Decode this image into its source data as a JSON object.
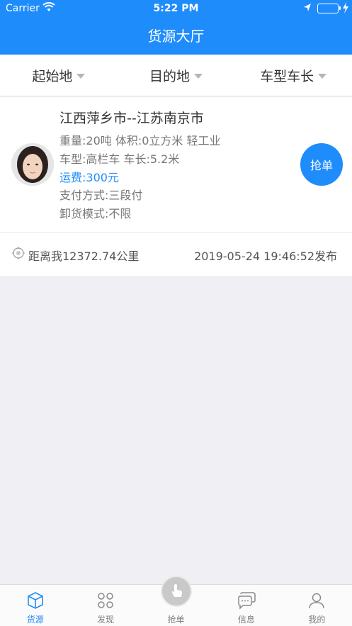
{
  "status_bar": {
    "carrier": "Carrier",
    "time": "5:22 PM",
    "battery_level": 1.0
  },
  "nav": {
    "title": "货源大厅"
  },
  "filters": [
    {
      "label": "起始地"
    },
    {
      "label": "目的地"
    },
    {
      "label": "车型车长"
    }
  ],
  "card": {
    "route": "江西萍乡市--江苏南京市",
    "spec": "重量:20吨  体积:0立方米  轻工业",
    "vehicle": "车型:高栏车  车长:5.2米",
    "fee": "运费:300元",
    "payment": "支付方式:三段付",
    "unload": "卸货模式:不限",
    "grab_label": "抢单",
    "distance": "距离我12372.74公里",
    "published": "2019-05-24 19:46:52发布"
  },
  "tabs": [
    {
      "label": "货源",
      "icon": "box-icon",
      "active": true
    },
    {
      "label": "发现",
      "icon": "grid-icon"
    },
    {
      "label": "抢单",
      "icon": "tap-hand-icon"
    },
    {
      "label": "信息",
      "icon": "chat-icon"
    },
    {
      "label": "我的",
      "icon": "person-icon"
    }
  ],
  "colors": {
    "accent": "#1f8cfb",
    "background": "#efeff4",
    "battery": "#4cd964"
  }
}
